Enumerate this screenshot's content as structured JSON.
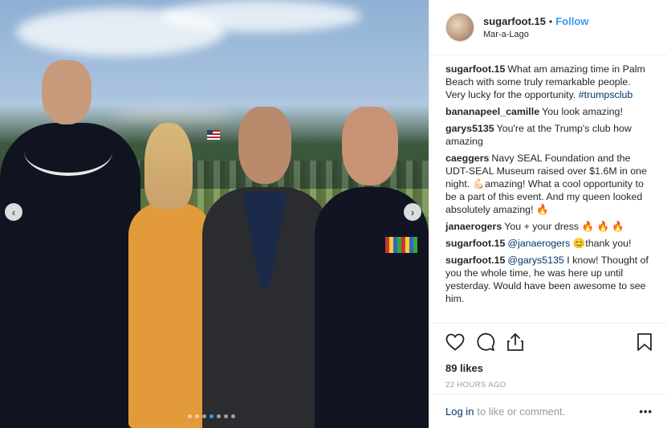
{
  "post": {
    "username": "sugarfoot.15",
    "separator": "•",
    "follow_label": "Follow",
    "location": "Mar-a-Lago"
  },
  "carousel": {
    "dot_count": 7,
    "active_dot": 3
  },
  "comments": [
    {
      "user": "sugarfoot.15",
      "parts": [
        {
          "t": "What am amazing time in Palm Beach with some truly remarkable people. Very lucky for the opportunity. "
        },
        {
          "t": "#trumpsclub",
          "link": true
        }
      ]
    },
    {
      "user": "bananapeel_camille",
      "parts": [
        {
          "t": "You look amazing!"
        }
      ]
    },
    {
      "user": "garys5135",
      "parts": [
        {
          "t": "You're at the Trump's club how amazing"
        }
      ]
    },
    {
      "user": "caeggers",
      "parts": [
        {
          "t": "Navy SEAL Foundation and the UDT-SEAL Museum raised over $1.6M in one night. 💪🏻amazing! What a cool opportunity to be a part of this event. And my queen looked absolutely amazing! "
        },
        {
          "t": "🔥",
          "fire": true
        }
      ]
    },
    {
      "user": "janaerogers",
      "parts": [
        {
          "t": "You + your dress "
        },
        {
          "t": "🔥 🔥 🔥",
          "fire": true
        }
      ]
    },
    {
      "user": "sugarfoot.15",
      "parts": [
        {
          "t": "@janaerogers",
          "link": true
        },
        {
          "t": " 😊thank you!"
        }
      ]
    },
    {
      "user": "sugarfoot.15",
      "parts": [
        {
          "t": "@garys5135",
          "link": true
        },
        {
          "t": " I know! Thought of you the whole time, he was here up until yesterday. Would have been awesome to see him."
        }
      ]
    }
  ],
  "stats": {
    "likes": "89 likes",
    "timestamp": "22 HOURS AGO"
  },
  "footer": {
    "login_label": "Log in",
    "rest": "to like or comment.",
    "more": "•••"
  },
  "icons": {
    "like": "heart-icon",
    "comment": "comment-icon",
    "share": "share-icon",
    "save": "bookmark-icon"
  }
}
